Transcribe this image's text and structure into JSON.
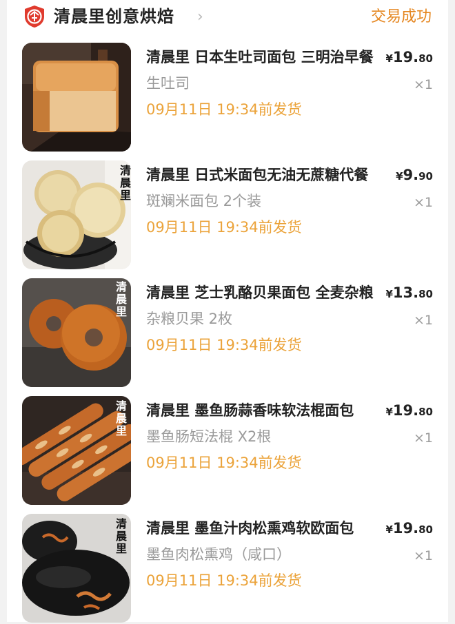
{
  "shop": {
    "icon": "shop-logo-icon",
    "name": "清晨里创意烘焙",
    "chevron": "›",
    "status": "交易成功"
  },
  "colors": {
    "status": "#e5861f",
    "shipping": "#eba33a",
    "secondary_text": "#9a9a9a",
    "icon_red": "#e03b2e"
  },
  "items": [
    {
      "title": "清晨里 日本生吐司面包 三明治早餐",
      "price_symbol": "¥",
      "price_int": "19.",
      "price_dec": "80",
      "spec": "生吐司",
      "qty": "×1",
      "ship": "09月11日 19:34前发货"
    },
    {
      "title": "清晨里 日式米面包无油无蔗糖代餐",
      "price_symbol": "¥",
      "price_int": "9.",
      "price_dec": "90",
      "spec": "斑斓米面包 2个装",
      "qty": "×1",
      "ship": "09月11日 19:34前发货"
    },
    {
      "title": "清晨里 芝士乳酪贝果面包 全麦杂粮",
      "price_symbol": "¥",
      "price_int": "13.",
      "price_dec": "80",
      "spec": "杂粮贝果 2枚",
      "qty": "×1",
      "ship": "09月11日 19:34前发货"
    },
    {
      "title": "清晨里 墨鱼肠蒜香味软法棍面包",
      "price_symbol": "¥",
      "price_int": "19.",
      "price_dec": "80",
      "spec": "墨鱼肠短法棍 X2根",
      "qty": "×1",
      "ship": "09月11日 19:34前发货"
    },
    {
      "title": "清晨里 墨鱼汁肉松熏鸡软欧面包",
      "price_symbol": "¥",
      "price_int": "19.",
      "price_dec": "80",
      "spec": "墨鱼肉松熏鸡（咸口）",
      "qty": "×1",
      "ship": "09月11日 19:34前发货"
    }
  ]
}
